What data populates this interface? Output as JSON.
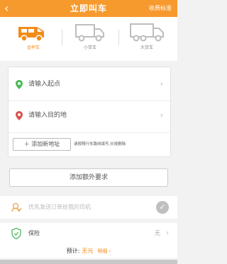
{
  "nav": {
    "back_glyph": "‹",
    "title": "立即叫车",
    "fee_link": "收费标准"
  },
  "vehicles": [
    {
      "label": "金杯车",
      "active": true,
      "icon": "van-icon"
    },
    {
      "label": "小货车",
      "active": false,
      "icon": "small-truck-icon"
    },
    {
      "label": "大货车",
      "active": false,
      "icon": "large-truck-icon"
    }
  ],
  "address": {
    "start_placeholder": "请输入起点",
    "end_placeholder": "请输入目的地",
    "chevron": "›",
    "add_button": "＋ 添加新地址",
    "add_hint": "请按照行车路线填写,长按删除"
  },
  "extra": {
    "label": "添加额外要求"
  },
  "driver": {
    "label": "优先发送订单给我的司机",
    "check": "✓"
  },
  "insurance": {
    "label": "保险",
    "value": "无"
  },
  "estimate": {
    "label": "预计:",
    "price": "无元",
    "detail": "明细 ›"
  },
  "colors": {
    "accent": "#f79a2e",
    "start_pin": "#4cb85a",
    "end_pin": "#d9534f"
  }
}
